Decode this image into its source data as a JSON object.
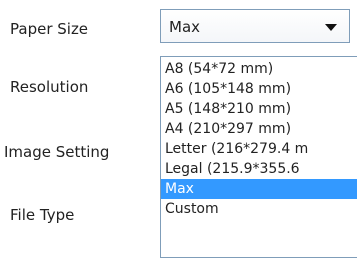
{
  "labels": {
    "paper_size": "Paper Size",
    "resolution": "Resolution",
    "image_setting": "Image Setting",
    "file_type": "File Type"
  },
  "paper_size_select": {
    "value": "Max",
    "options": [
      "A8 (54*72 mm)",
      "A6 (105*148 mm)",
      "A5 (148*210 mm)",
      "A4 (210*297 mm)",
      "Letter (216*279.4 m",
      "Legal (215.9*355.6",
      "Max",
      "Custom"
    ],
    "selected_index": 6
  },
  "colors": {
    "highlight": "#3399ff",
    "border": "#7f9db9"
  }
}
